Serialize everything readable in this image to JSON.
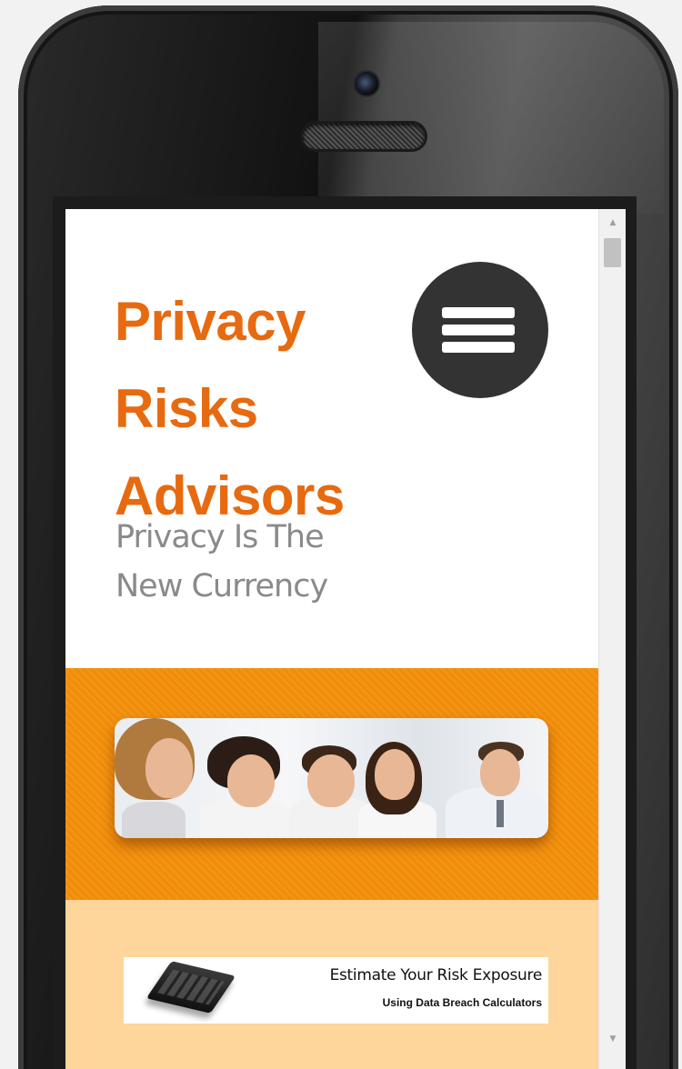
{
  "site": {
    "title_lines": [
      "Privacy",
      "Risks",
      "Advisors"
    ],
    "tagline_lines": [
      "Privacy Is The",
      "New Currency"
    ]
  },
  "menu": {
    "icon": "hamburger-menu-icon"
  },
  "banner": {
    "image": "business-team-photo"
  },
  "calculator_banner": {
    "icon": "calculator-icon",
    "title": "Estimate Your Risk Exposure",
    "subtitle": "Using Data Breach Calculators"
  },
  "scrollbar": {
    "up_arrow": "▲",
    "down_arrow": "▼"
  },
  "colors": {
    "brand_orange": "#e76a10",
    "banner_orange": "#f39512",
    "section_peach": "#fed59b",
    "menu_dark": "#333333"
  }
}
